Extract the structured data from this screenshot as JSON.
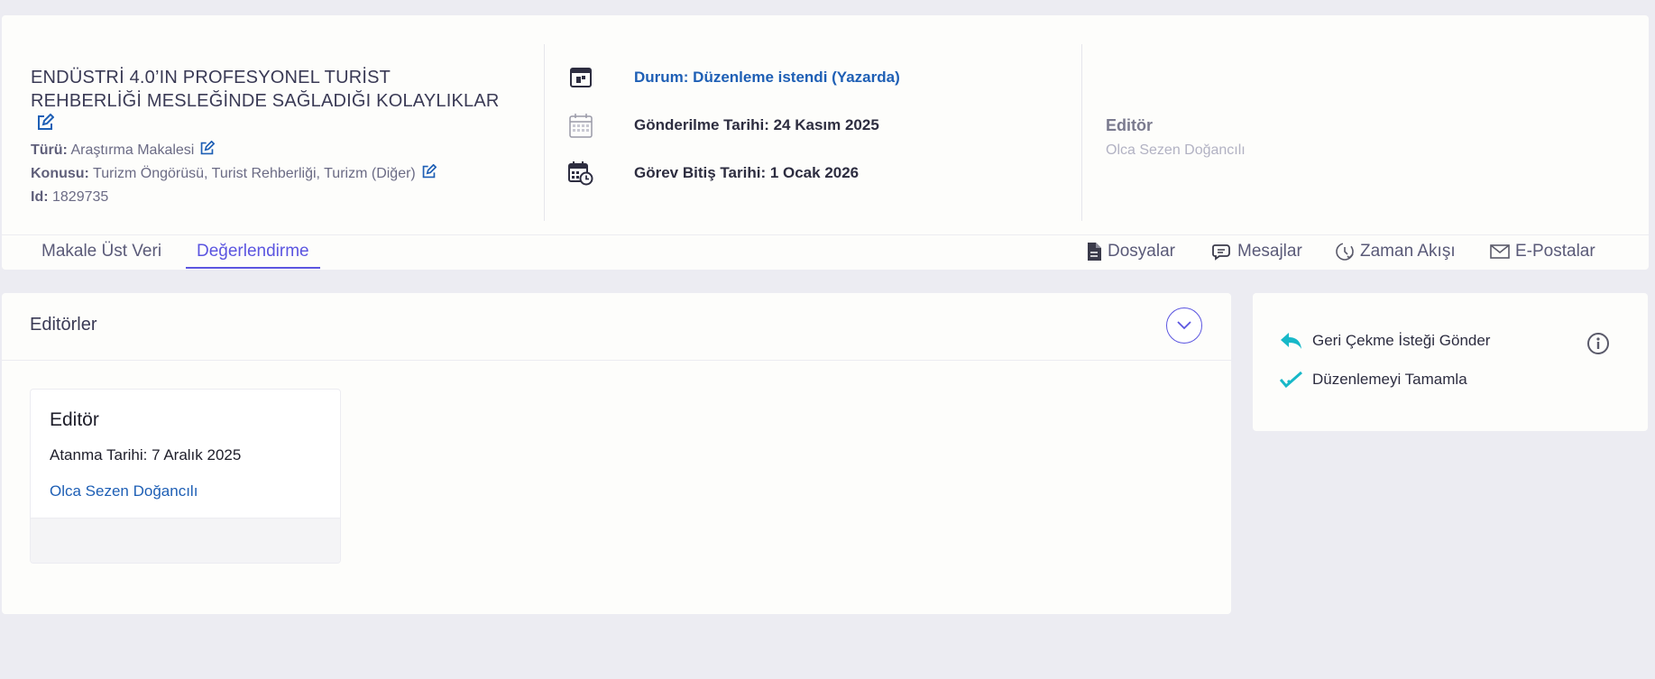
{
  "article": {
    "title": "ENDÜSTRİ 4.0’IN PROFESYONEL TURİST REHBERLİĞİ MESLEĞİNDE SAĞLADIĞI KOLAYLIKLAR",
    "type_label": "Türü:",
    "type_value": "Araştırma Makalesi",
    "subject_label": "Konusu:",
    "subject_value": "Turizm Öngörüsü, Turist Rehberliği, Turizm (Diğer)",
    "id_label": "Id:",
    "id_value": "1829735"
  },
  "status": {
    "state": "Durum: Düzenleme istendi (Yazarda)",
    "submitted": "Gönderilme Tarihi: 24 Kasım 2025",
    "due": "Görev Bitiş Tarihi: 1 Ocak 2026"
  },
  "editor_summary": {
    "label": "Editör",
    "name": "Olca Sezen Doğancılı"
  },
  "tabs": [
    {
      "label": "Makale Üst Veri",
      "active": false
    },
    {
      "label": "Değerlendirme",
      "active": true
    }
  ],
  "side_links": [
    {
      "label": "Dosyalar",
      "icon": "file-icon"
    },
    {
      "label": "Mesajlar",
      "icon": "chat-icon"
    },
    {
      "label": "Zaman Akışı",
      "icon": "timeline-icon"
    },
    {
      "label": "E-Postalar",
      "icon": "envelope-icon"
    }
  ],
  "editors_panel": {
    "title": "Editörler",
    "card": {
      "role": "Editör",
      "assigned": "Atanma Tarihi: 7 Aralık 2025",
      "name": "Olca Sezen Doğancılı"
    }
  },
  "actions": [
    {
      "label": "Geri Çekme İsteği Gönder",
      "icon": "reply-icon"
    },
    {
      "label": "Düzenlemeyi Tamamla",
      "icon": "double-check-icon"
    }
  ],
  "colors": {
    "accent": "#5b55e0",
    "link": "#1e5fb5",
    "action_icon": "#17b8c8",
    "background": "#ececf2"
  }
}
